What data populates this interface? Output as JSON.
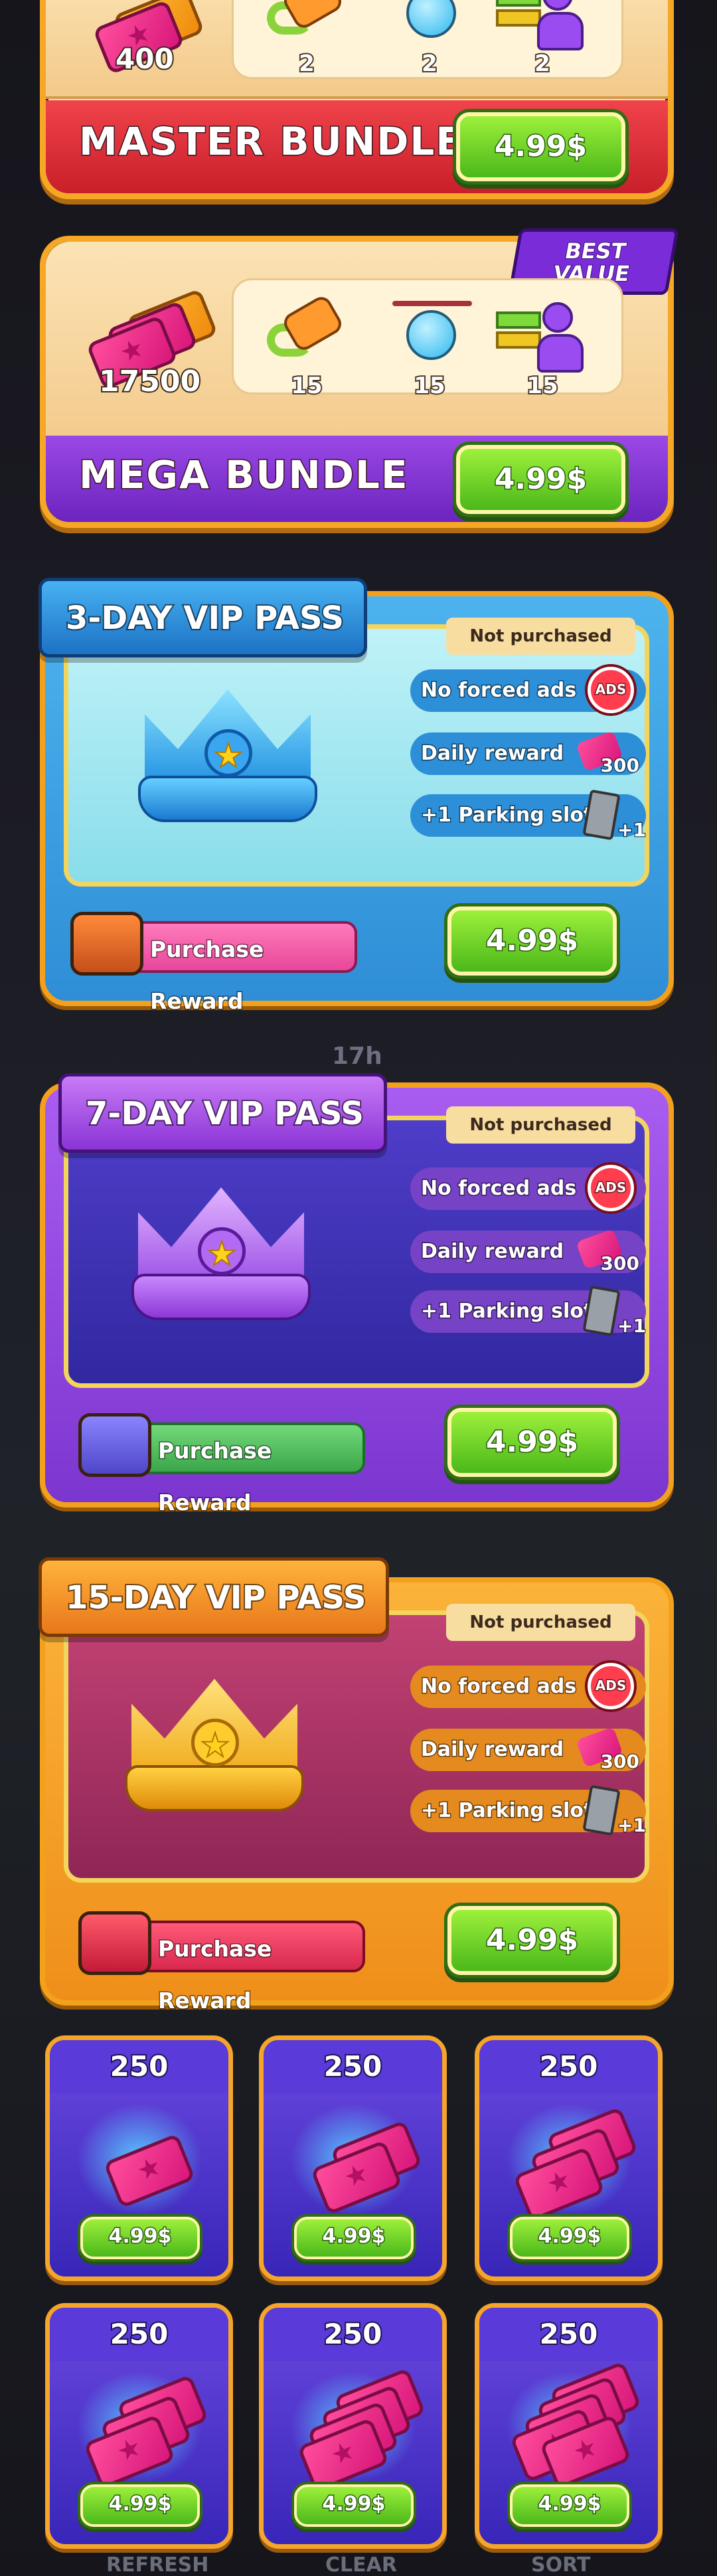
{
  "bundles": [
    {
      "name": "MASTER BUNDLE",
      "tickets": "400",
      "items": [
        "2",
        "2",
        "2"
      ],
      "price": "4.99$",
      "band_color": "#e8313b"
    },
    {
      "name": "MEGA BUNDLE",
      "tickets": "17500",
      "items": [
        "15",
        "15",
        "15"
      ],
      "price": "4.99$",
      "band_color": "#8a3ad8",
      "badge": "BEST\nVALUE"
    }
  ],
  "vip_passes": [
    {
      "title": "3-DAY VIP PASS",
      "status": "Not purchased",
      "perks": [
        "No forced ads",
        "Daily reward",
        "+1 Parking slot"
      ],
      "reward_amount": "300",
      "slot_amount": "+1",
      "purchase_label": "Purchase Reward",
      "price": "4.99$",
      "theme": "#4fb6f0"
    },
    {
      "title": "7-DAY VIP PASS",
      "status": "Not purchased",
      "perks": [
        "No forced ads",
        "Daily reward",
        "+1 Parking slot"
      ],
      "reward_amount": "300",
      "slot_amount": "+1",
      "purchase_label": "Purchase Reward",
      "price": "4.99$",
      "theme": "#a04ee8"
    },
    {
      "title": "15-DAY VIP PASS",
      "status": "Not purchased",
      "perks": [
        "No forced ads",
        "Daily reward",
        "+1 Parking slot"
      ],
      "reward_amount": "300",
      "slot_amount": "+1",
      "purchase_label": "Purchase Reward",
      "price": "4.99$",
      "theme": "#f4a020"
    }
  ],
  "packs": [
    {
      "amount": "250",
      "price": "4.99$"
    },
    {
      "amount": "250",
      "price": "4.99$"
    },
    {
      "amount": "250",
      "price": "4.99$"
    },
    {
      "amount": "250",
      "price": "4.99$"
    },
    {
      "amount": "250",
      "price": "4.99$"
    },
    {
      "amount": "250",
      "price": "4.99$"
    }
  ],
  "icons": {
    "ads": "ADS",
    "gem_star": "★"
  },
  "background_labels": {
    "left": "REFRESH",
    "center": "CLEAR",
    "right": "SORT",
    "timer": "17h"
  }
}
